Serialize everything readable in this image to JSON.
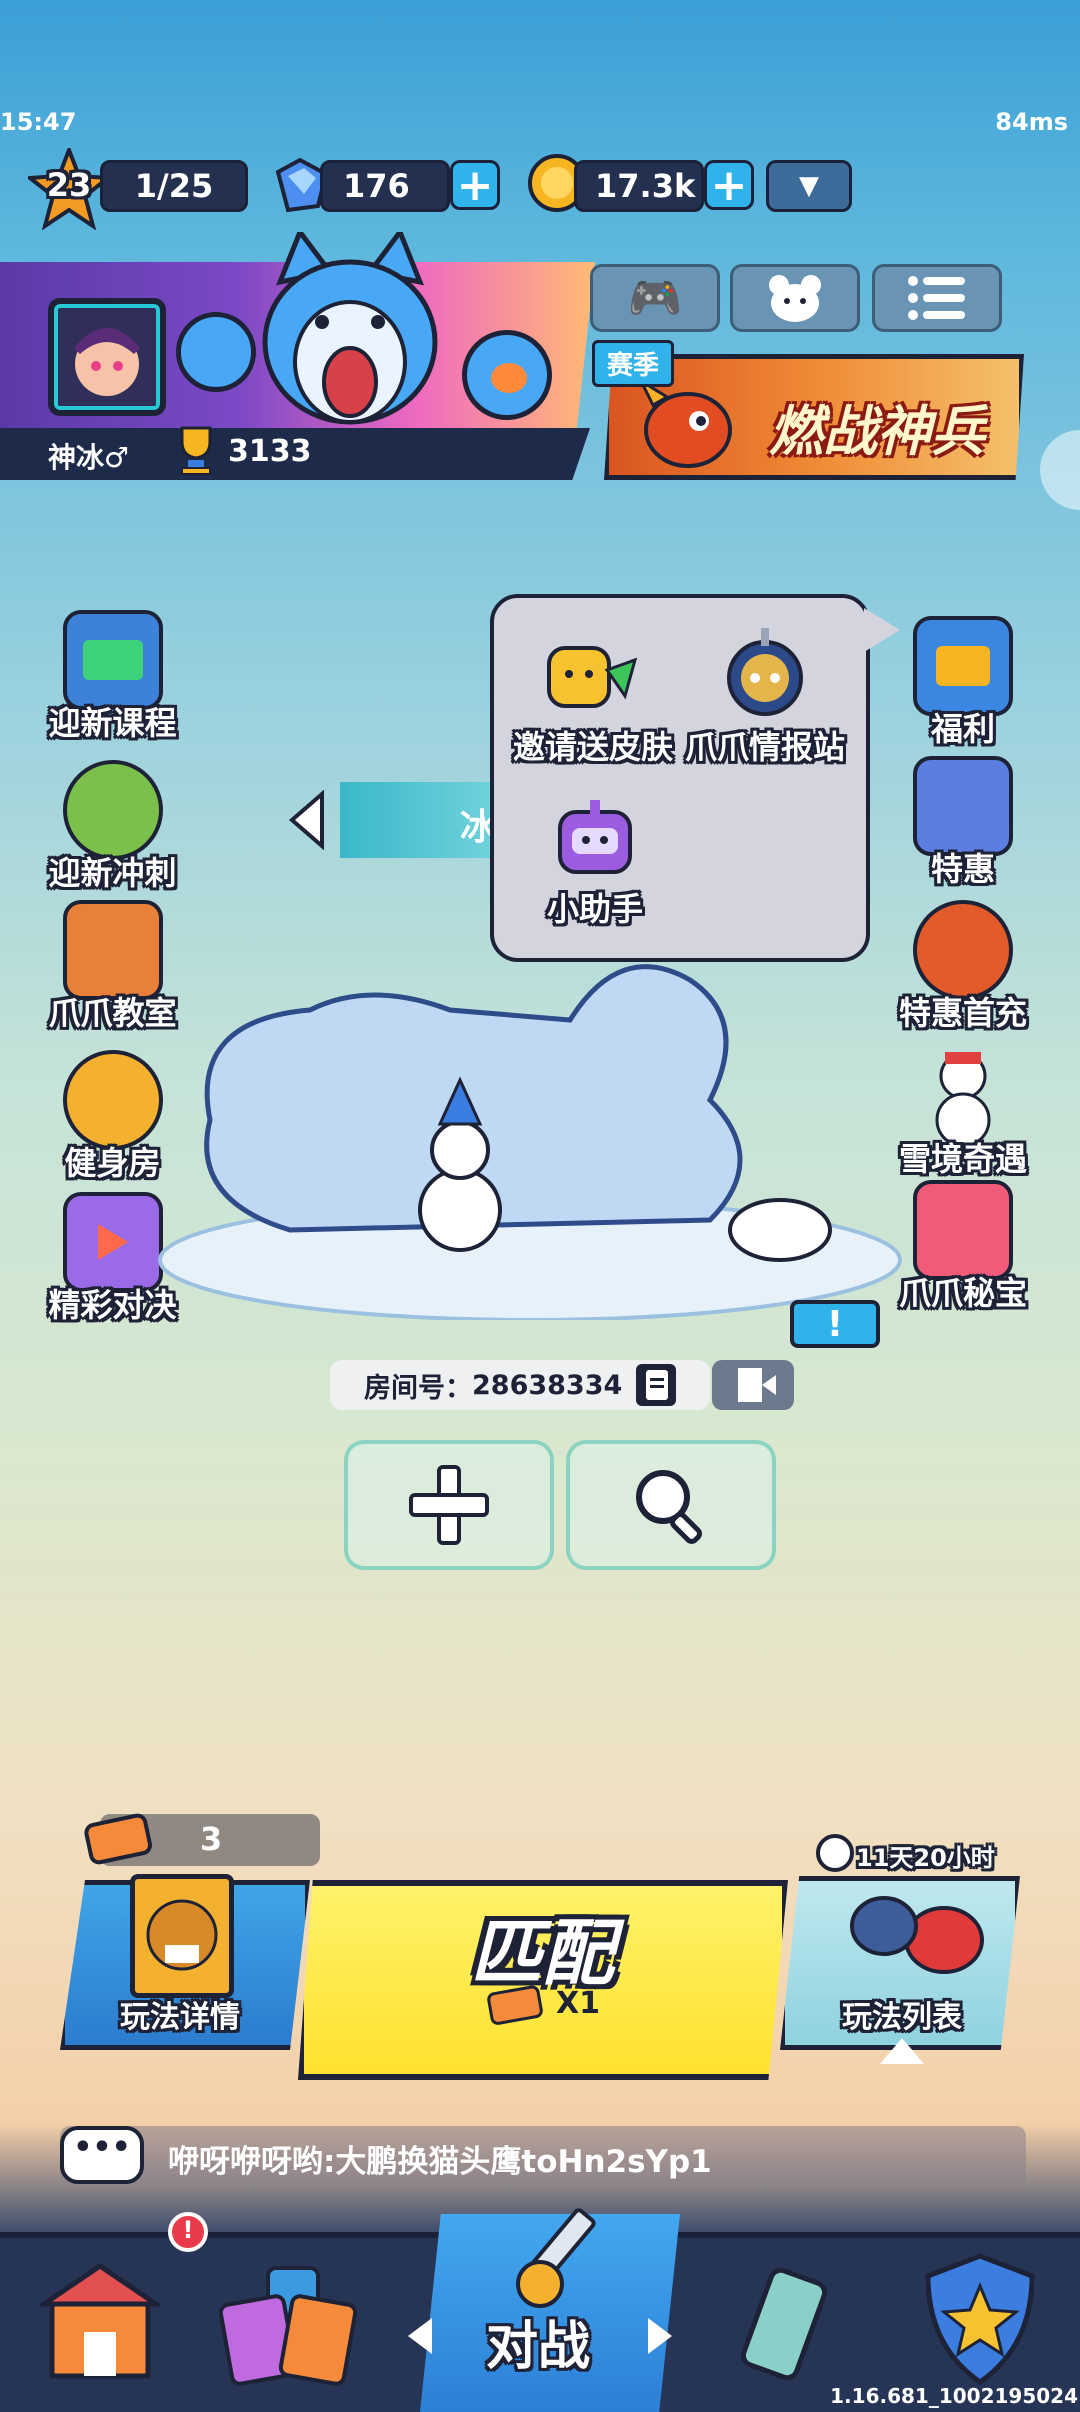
{
  "status": {
    "time": "15:47",
    "ping": "84ms"
  },
  "player": {
    "level": "23",
    "season_progress": "1/25",
    "gems": "176",
    "coins": "17.3k",
    "name": "神冰♂",
    "trophies": "3133"
  },
  "season_banner": {
    "tag": "赛季",
    "title": "燃战神兵"
  },
  "left_menu": [
    {
      "label": "迎新课程",
      "icon": "calendar-icon"
    },
    {
      "label": "迎新冲刺",
      "icon": "sprint-icon"
    },
    {
      "label": "爪爪教室",
      "icon": "classroom-icon"
    },
    {
      "label": "健身房",
      "icon": "gym-icon"
    },
    {
      "label": "精彩对决",
      "icon": "video-icon"
    }
  ],
  "right_menu": [
    {
      "label": "福利",
      "icon": "gift-icon"
    },
    {
      "label": "特惠",
      "icon": "deal-icon"
    },
    {
      "label": "特惠首充",
      "icon": "fox-icon"
    },
    {
      "label": "雪境奇遇",
      "icon": "snowman-icon"
    },
    {
      "label": "爪爪秘宝",
      "icon": "shirt-icon"
    }
  ],
  "popup": {
    "items": [
      {
        "label": "邀请送皮肤",
        "icon": "invite-icon"
      },
      {
        "label": "爪爪情报站",
        "icon": "radar-icon"
      },
      {
        "label": "小助手",
        "icon": "robot-icon"
      }
    ]
  },
  "mode_banner_fragment": "冰",
  "room": {
    "label": "房间号：",
    "number": "28638334"
  },
  "bottom": {
    "tickets": "3",
    "mode_detail": "玩法详情",
    "match": "匹配",
    "match_cost": "X1",
    "timer": "11天20小时",
    "mode_list": "玩法列表"
  },
  "chat": {
    "message": "咿呀咿呀哟:大鹏换猫头鹰toHn2sYp1"
  },
  "nav": {
    "battle": "对战",
    "badge": "!"
  },
  "version": "1.16.681_1002195024",
  "colors": {
    "accent_blue": "#2fb3ea",
    "match_yellow": "#ffe22f",
    "dark_outline": "#1d2236"
  }
}
